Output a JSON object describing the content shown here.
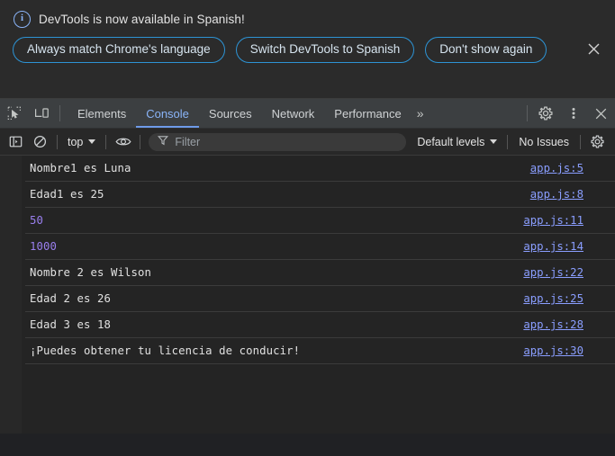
{
  "banner": {
    "icon": "info-circle-icon",
    "message": "DevTools is now available in Spanish!",
    "buttons": [
      {
        "label": "Always match Chrome's language"
      },
      {
        "label": "Switch DevTools to Spanish"
      },
      {
        "label": "Don't show again"
      }
    ],
    "close_icon": "close-icon",
    "accent_color": "#2d93d4",
    "background": "#2b2b2b"
  },
  "tabbar": {
    "inspect_icon": "inspect-element-icon",
    "device_icon": "device-toolbar-icon",
    "tabs": [
      {
        "label": "Elements",
        "active": false
      },
      {
        "label": "Console",
        "active": true
      },
      {
        "label": "Sources",
        "active": false
      },
      {
        "label": "Network",
        "active": false
      },
      {
        "label": "Performance",
        "active": false
      }
    ],
    "more_tabs": "»",
    "settings_icon": "gear-icon",
    "kebab_icon": "more-options-icon",
    "close_icon": "close-devtools-icon",
    "active_color": "#8ab4f8",
    "background": "#3c3f41"
  },
  "console_toolbar": {
    "sidebar_icon": "console-sidebar-icon",
    "clear_icon": "clear-console-icon",
    "context_label": "top",
    "eye_icon": "live-expression-eye-icon",
    "filter_icon": "filter-funnel-icon",
    "filter_placeholder": "Filter",
    "filter_value": "",
    "levels_label": "Default levels",
    "issues_label": "No Issues",
    "settings_icon": "console-settings-gear-icon",
    "background": "#282828"
  },
  "console": {
    "background": "#242424",
    "text_color": "#e0e0e0",
    "number_color": "#9a7fee",
    "link_color": "#8a9eff",
    "messages": [
      {
        "text": "Nombre1 es Luna",
        "source": "app.js:5",
        "kind": "string"
      },
      {
        "text": "Edad1 es 25",
        "source": "app.js:8",
        "kind": "string"
      },
      {
        "text": "50",
        "source": "app.js:11",
        "kind": "number"
      },
      {
        "text": "1000",
        "source": "app.js:14",
        "kind": "number"
      },
      {
        "text": "Nombre 2 es Wilson",
        "source": "app.js:22",
        "kind": "string"
      },
      {
        "text": "Edad 2 es 26",
        "source": "app.js:25",
        "kind": "string"
      },
      {
        "text": "Edad 3 es 18",
        "source": "app.js:28",
        "kind": "string"
      },
      {
        "text": "¡Puedes obtener tu licencia de conducir!",
        "source": "app.js:30",
        "kind": "string"
      }
    ],
    "prompt_caret": "›",
    "prompt_value": ""
  }
}
